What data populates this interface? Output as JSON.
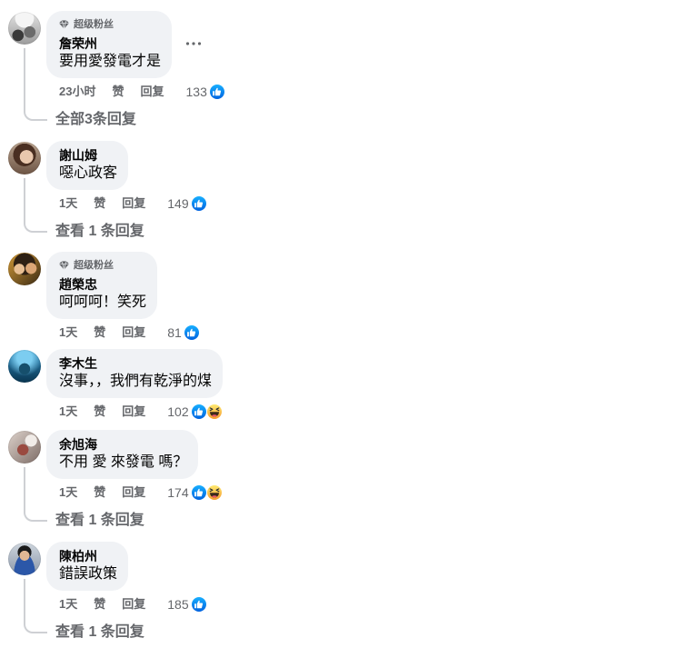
{
  "actions": {
    "like": "赞",
    "reply": "回复"
  },
  "comments": [
    {
      "badge": "超级粉丝",
      "name": "詹荣州",
      "text": "要用愛發電才是",
      "time": "23小时",
      "reaction_count": "133",
      "reactions": [
        "like"
      ],
      "replies_link": "全部3条回复"
    },
    {
      "name": "謝山姆",
      "text": "噁心政客",
      "time": "1天",
      "reaction_count": "149",
      "reactions": [
        "like"
      ],
      "replies_link": "查看 1 条回复"
    },
    {
      "badge": "超级粉丝",
      "name": "趙榮忠",
      "text": "呵呵呵！笑死",
      "time": "1天",
      "reaction_count": "81",
      "reactions": [
        "like"
      ]
    },
    {
      "name": "李木生",
      "text": "沒事，，我們有乾淨的煤",
      "time": "1天",
      "reaction_count": "102",
      "reactions": [
        "like",
        "haha"
      ]
    },
    {
      "name": "余旭海",
      "text": "不用 愛 來發電 嗎？",
      "time": "1天",
      "reaction_count": "174",
      "reactions": [
        "like",
        "haha"
      ],
      "replies_link": "查看 1 条回复"
    },
    {
      "name": "陳柏州",
      "text": "錯誤政策",
      "time": "1天",
      "reaction_count": "185",
      "reactions": [
        "like"
      ],
      "replies_link": "查看 1 条回复"
    }
  ],
  "icons": {
    "badge": "diamond-icon",
    "more_options": "more-options-icon",
    "like": "like-reaction-icon",
    "haha": "haha-reaction-icon"
  },
  "colors": {
    "bubble_bg": "#f0f2f5",
    "primary_text": "#050505",
    "secondary_text": "#65676b",
    "thread_line": "#ced0d4",
    "like_blue": "#0866ff",
    "haha_yellow": "#fcd353"
  }
}
